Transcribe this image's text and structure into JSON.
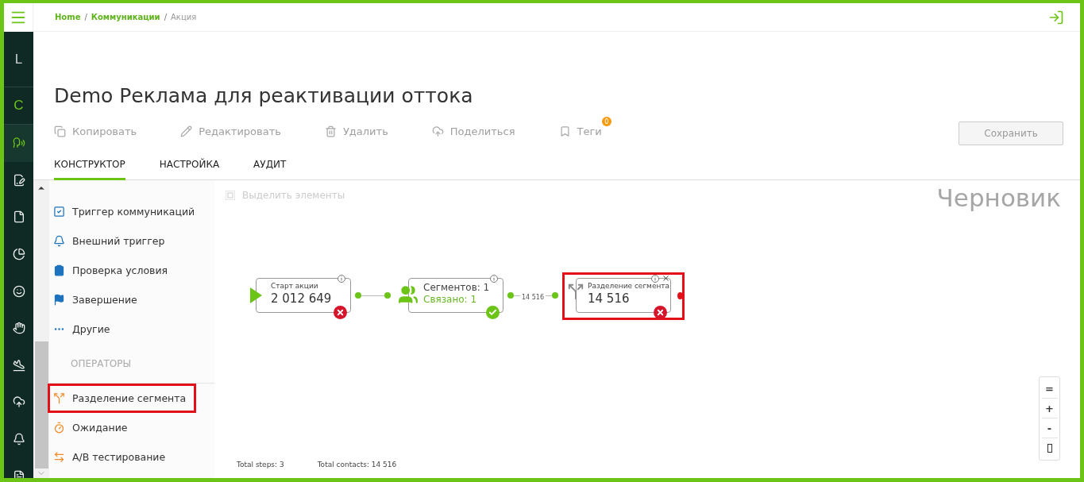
{
  "breadcrumbs": [
    {
      "kind": "link",
      "label": "Home"
    },
    {
      "kind": "separator",
      "label": "/"
    },
    {
      "kind": "link",
      "label": "Коммуникации"
    },
    {
      "kind": "separator",
      "label": "/"
    },
    {
      "kind": "current",
      "label": "Акция"
    }
  ],
  "rail": [
    {
      "kind": "letter",
      "label": "L",
      "selected": false
    },
    {
      "kind": "letter",
      "label": "C",
      "selected": true
    },
    {
      "kind": "icon",
      "selected": true
    },
    {
      "kind": "icon",
      "selected": false
    },
    {
      "kind": "icon",
      "selected": false
    },
    {
      "kind": "icon",
      "selected": false
    },
    {
      "kind": "icon",
      "selected": false
    },
    {
      "kind": "icon",
      "selected": false
    },
    {
      "kind": "icon",
      "selected": false
    },
    {
      "kind": "icon",
      "selected": false
    },
    {
      "kind": "icon",
      "selected": false
    },
    {
      "kind": "icon",
      "selected": false
    }
  ],
  "title": "Demo Реклама для реактивации оттока",
  "actions": [
    {
      "kind": "copy",
      "label": "Копировать"
    },
    {
      "kind": "edit",
      "label": "Редактировать"
    },
    {
      "kind": "delete",
      "label": "Удалить"
    },
    {
      "kind": "share",
      "label": "Поделиться"
    },
    {
      "kind": "tags",
      "label": "Теги",
      "badge": "0"
    }
  ],
  "save_button": {
    "label": "Сохранить",
    "disabled": true
  },
  "tabs": [
    {
      "label": "КОНСТРУКТОР",
      "selected": true
    },
    {
      "label": "НАСТРОЙКА",
      "selected": false
    },
    {
      "label": "АУДИТ",
      "selected": false
    }
  ],
  "palette": {
    "events": [
      {
        "kind": "trigger",
        "label": "Триггер коммуникаций",
        "highlighted": false
      },
      {
        "kind": "external",
        "label": "Внешний триггер",
        "highlighted": false
      },
      {
        "kind": "condition",
        "label": "Проверка условия",
        "highlighted": false
      },
      {
        "kind": "finish",
        "label": "Завершение",
        "highlighted": false
      },
      {
        "kind": "other",
        "label": "Другие",
        "highlighted": false
      }
    ],
    "operators_title": "ОПЕРАТОРЫ",
    "operators": [
      {
        "kind": "split",
        "label": "Разделение сегмента",
        "highlighted": true
      },
      {
        "kind": "wait",
        "label": "Ожидание",
        "highlighted": false
      },
      {
        "kind": "ab",
        "label": "А/В тестирование",
        "highlighted": false
      }
    ]
  },
  "canvas": {
    "select_label": "Выделить элементы",
    "status": "Черновик",
    "nodes": [
      {
        "kind": "start",
        "title": "Старт акции",
        "value": "2 012 649",
        "ok": false,
        "highlighted": false
      },
      {
        "kind": "segments",
        "title": "Сегментов: 1",
        "value": "Связано: 1",
        "ok": true,
        "highlighted": false
      },
      {
        "kind": "split",
        "title": "Разделение сегмента",
        "value": "14 516",
        "ok": false,
        "highlighted": true
      }
    ],
    "links": [
      {
        "kind": "plain"
      },
      {
        "kind": "counted",
        "label": "14 516"
      }
    ],
    "stats": [
      "Total steps: 3",
      "Total contacts: 14 516"
    ],
    "zoom_controls": [
      "=",
      "+",
      "-"
    ]
  }
}
